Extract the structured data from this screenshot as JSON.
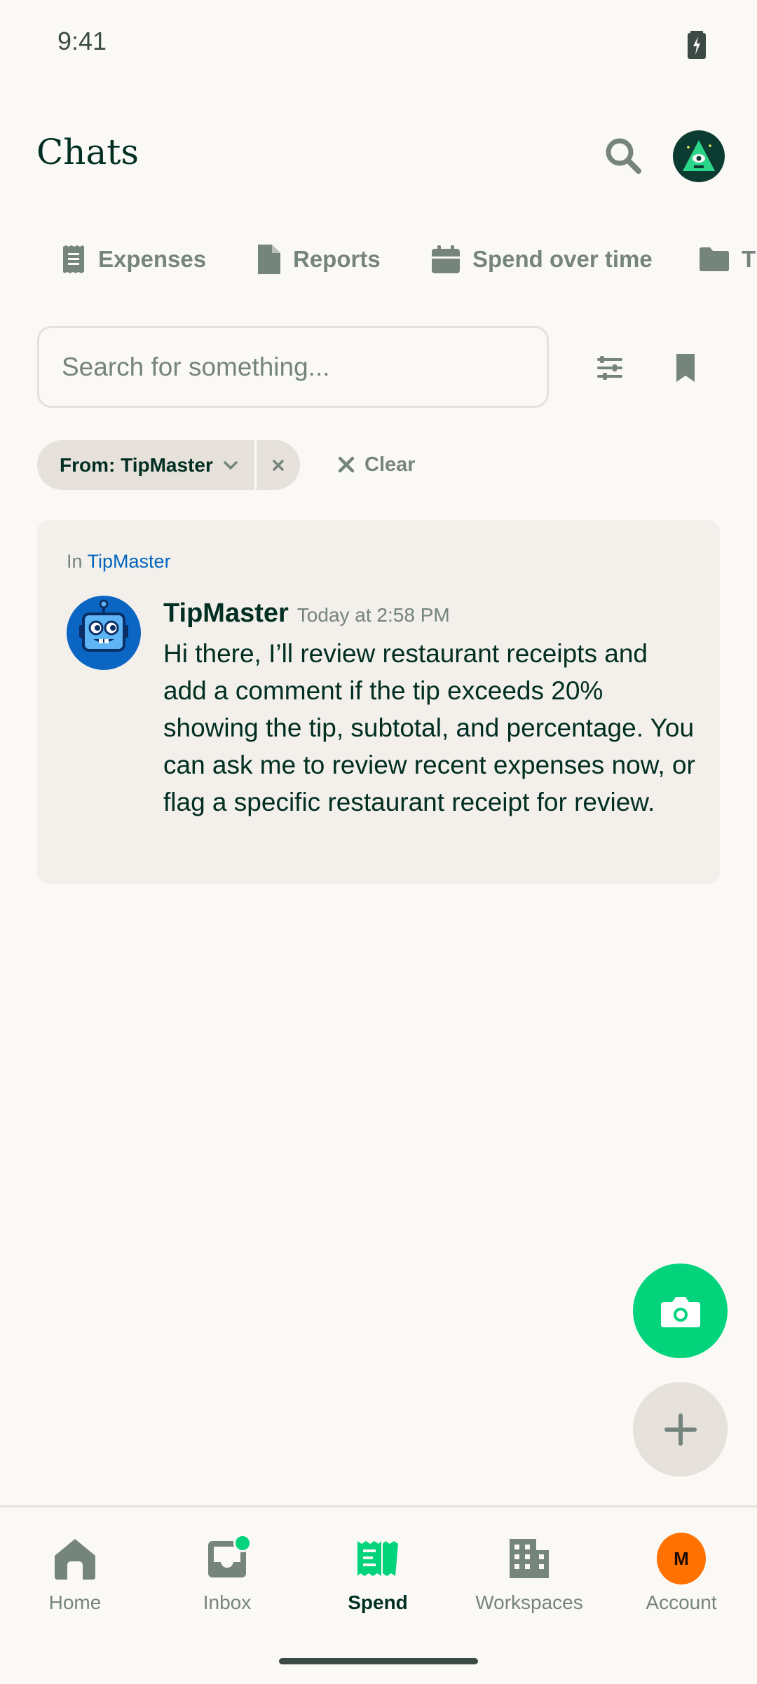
{
  "status_bar": {
    "time": "9:41"
  },
  "header": {
    "title": "Chats"
  },
  "tabs": [
    {
      "label": "Expenses",
      "icon": "receipt-icon"
    },
    {
      "label": "Reports",
      "icon": "document-icon"
    },
    {
      "label": "Spend over time",
      "icon": "calendar-icon"
    },
    {
      "label": "T",
      "icon": "folder-icon"
    }
  ],
  "search": {
    "placeholder": "Search for something...",
    "value": ""
  },
  "filters": {
    "chip_label": "From: TipMaster",
    "clear_label": "Clear"
  },
  "result": {
    "in_prefix": "In",
    "in_link": "TipMaster",
    "sender": "TipMaster",
    "time": "Today at 2:58 PM",
    "message": "Hi there, I’ll review restaurant receipts and add a comment if the tip exceeds 20% showing the tip, subtotal, and percentage. You can ask me to review recent expenses now, or flag a specific restaurant receipt for review."
  },
  "bottom_nav": {
    "items": [
      {
        "label": "Home",
        "icon": "home-icon"
      },
      {
        "label": "Inbox",
        "icon": "inbox-icon"
      },
      {
        "label": "Spend",
        "icon": "spend-icon",
        "active": true
      },
      {
        "label": "Workspaces",
        "icon": "building-icon"
      },
      {
        "label": "Account",
        "icon": "account-avatar"
      }
    ],
    "account_initial": "M"
  },
  "colors": {
    "accent_green": "#03D47C",
    "text_dark": "#002E22",
    "text_muted": "#76847E",
    "link_blue": "#0164BF",
    "account_orange": "#FF7101"
  }
}
